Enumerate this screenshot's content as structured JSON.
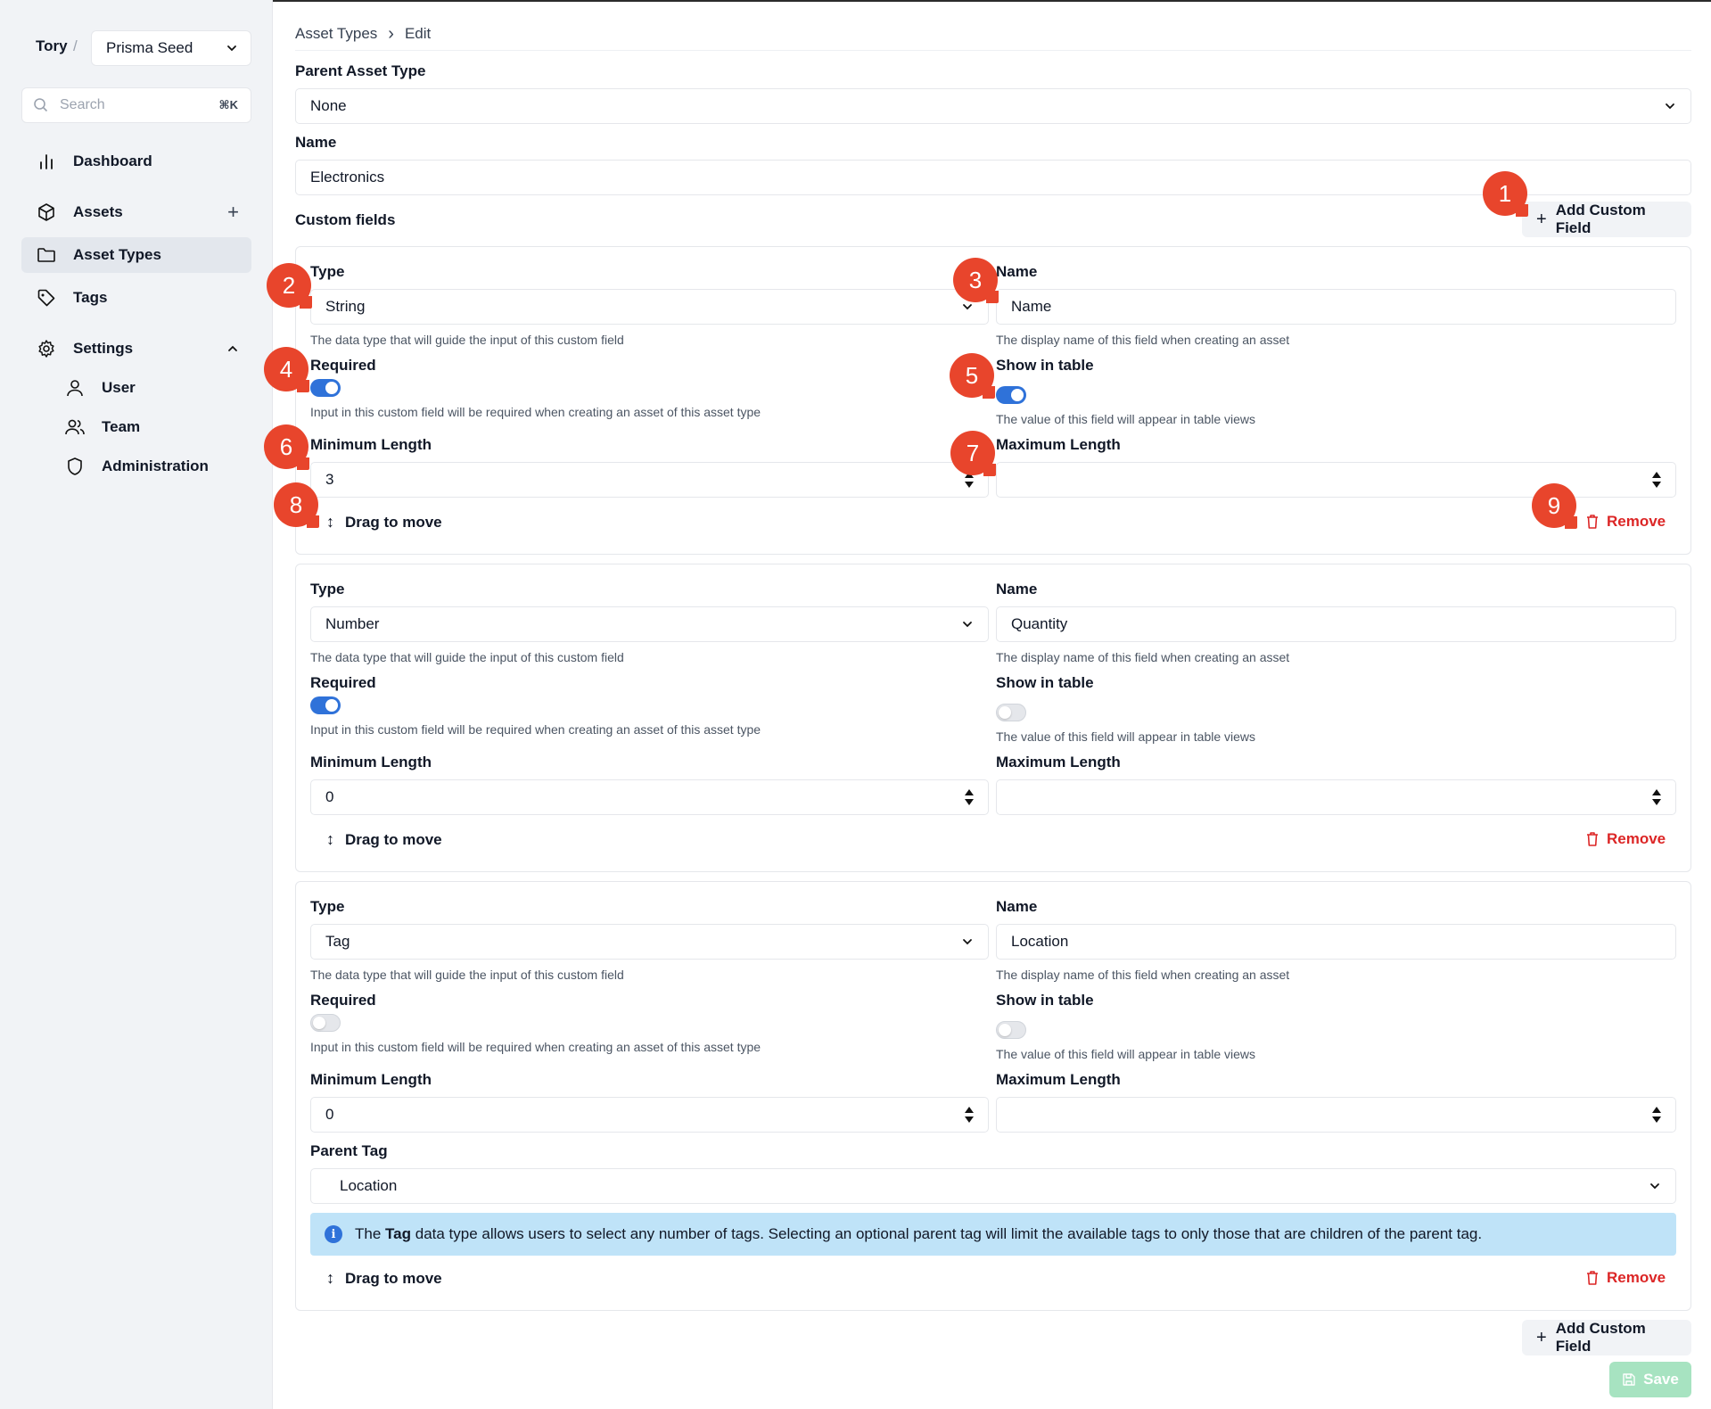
{
  "sidebar": {
    "org": "Tory",
    "separator": "/",
    "project": "Prisma Seed",
    "search": {
      "placeholder": "Search",
      "shortcut": "⌘K"
    },
    "items": [
      {
        "label": "Dashboard",
        "icon": "bar-chart-icon"
      },
      {
        "label": "Assets",
        "icon": "cube-icon",
        "action": "+"
      },
      {
        "label": "Asset Types",
        "icon": "folder-icon",
        "active": true
      },
      {
        "label": "Tags",
        "icon": "tag-icon"
      },
      {
        "label": "Settings",
        "icon": "gear-icon"
      },
      {
        "label": "User",
        "icon": "user-icon"
      },
      {
        "label": "Team",
        "icon": "users-icon"
      },
      {
        "label": "Administration",
        "icon": "shield-icon"
      }
    ]
  },
  "breadcrumb": {
    "parent": "Asset Types",
    "separator": "›",
    "current": "Edit"
  },
  "form": {
    "parent_label": "Parent Asset Type",
    "parent_value": "None",
    "name_label": "Name",
    "name_value": "Electronics",
    "custom_fields_label": "Custom fields",
    "add_custom_field": "Add Custom Field",
    "save": "Save"
  },
  "field_labels": {
    "type": "Type",
    "name": "Name",
    "type_help": "The data type that will guide the input of this custom field",
    "name_help": "The display name of this field when creating an asset",
    "required": "Required",
    "required_help": "Input in this custom field will be required when creating an asset of this asset type",
    "show_in_table": "Show in table",
    "show_help": "The value of this field will appear in table views",
    "min_length": "Minimum Length",
    "max_length": "Maximum Length",
    "drag": "Drag to move",
    "remove": "Remove",
    "parent_tag": "Parent Tag"
  },
  "custom_fields": [
    {
      "type": "String",
      "name": "Name",
      "required": true,
      "show_in_table": true,
      "min_length": "3",
      "max_length": ""
    },
    {
      "type": "Number",
      "name": "Quantity",
      "required": true,
      "show_in_table": false,
      "min_length": "0",
      "max_length": ""
    },
    {
      "type": "Tag",
      "name": "Location",
      "required": false,
      "show_in_table": false,
      "min_length": "0",
      "max_length": "",
      "parent_tag": "Location"
    }
  ],
  "tag_info": {
    "prefix": "The",
    "bold": "Tag",
    "suffix": "data type allows users to select any number of tags. Selecting an optional parent tag will limit the available tags to only those that are children of the parent tag."
  },
  "callouts": [
    "1",
    "2",
    "3",
    "4",
    "5",
    "6",
    "7",
    "8",
    "9"
  ],
  "colors": {
    "accent": "#2f72d9",
    "danger": "#dc2626",
    "callout": "#e8452c",
    "save_disabled": "#a7e3c1",
    "info_bg": "#bfe3f8"
  }
}
